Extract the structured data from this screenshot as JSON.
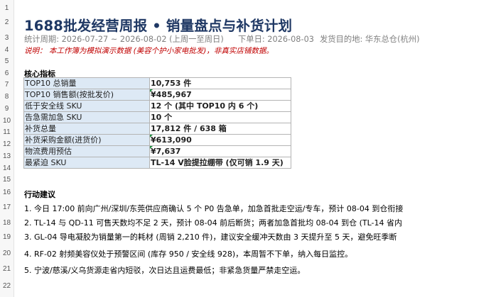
{
  "row_numbers": [
    "1",
    "2",
    "3",
    "4",
    "5",
    "6",
    "7",
    "8",
    "9",
    "10",
    "11",
    "12",
    "13",
    "14",
    "15",
    "16",
    "17",
    "18",
    "19",
    "20",
    "21",
    "22"
  ],
  "report": {
    "title": "1688批发经营周报 • 销量盘点与补货计划",
    "period": "统计周期:  2026-07-27 ~ 2026-08-02 (上周一至周日)",
    "order_date": "下单日: 2026-08-03",
    "ship_from": "发货目的地: 华东总仓(杭州)",
    "note": "说明：  本工作簿为模拟演示数据 (美容个护小家电批发)，非真实店铺数据。"
  },
  "kpi_section_title": "核心指标",
  "kpis": [
    {
      "label": "TOP10 总销量",
      "value": "10,753 件",
      "flag": false
    },
    {
      "label": "TOP10 销售额(按批发价)",
      "value": "¥485,967",
      "flag": true
    },
    {
      "label": "低于安全线 SKU",
      "value": "12 个 (其中 TOP10 内 6 个)",
      "flag": false
    },
    {
      "label": "告急需加急 SKU",
      "value": "10 个",
      "flag": false
    },
    {
      "label": "补货总量",
      "value": "17,812 件 / 638 箱",
      "flag": false
    },
    {
      "label": "补货采购金额(进货价)",
      "value": "¥613,090",
      "flag": true
    },
    {
      "label": "物流费用预估",
      "value": "¥7,637",
      "flag": true
    },
    {
      "label": "最紧迫 SKU",
      "value": "TL-14 V脸提拉绷带 (仅可销 1.9 天)",
      "flag": false
    }
  ],
  "actions_section_title": "行动建议",
  "actions": [
    "1. 今日 17:00 前向广州/深圳/东莞供应商确认 5 个 P0 告急单，加急首批走空运/专车，预计 08-04 到仓衔接",
    "2. TL-14 与 QD-11 可售天数均不足 2 天，预计 08-04 前后断货；两者加急首批均 08-04 到仓 (TL-14 省内",
    "3. GL-04 导电凝胶为销量第一的耗材 (周销 2,210 件)，建议安全缓冲天数由 3 天提升至 5 天，避免旺季断",
    "4. RF-02 射频美容仪处于预警区间 (库存 950 / 安全线 928)，本周暂不下单，纳入每日监控。",
    "5. 宁波/慈溪/义乌货源走省内短驳，次日达且运费最低；非紧急货量严禁走空运。"
  ]
}
